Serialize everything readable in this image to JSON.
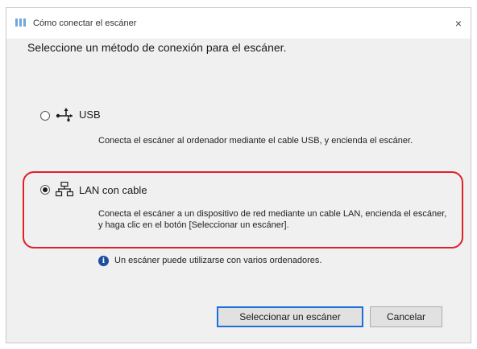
{
  "window": {
    "title": "Cómo conectar el escáner",
    "close_glyph": "×"
  },
  "heading": "Seleccione un método de conexión para el escáner.",
  "options": [
    {
      "label": "USB",
      "description": "Conecta el escáner al ordenador mediante el cable USB, y encienda el escáner.",
      "selected": false,
      "icon": "usb-icon"
    },
    {
      "label": "LAN con cable",
      "description": "Conecta el escáner a un dispositivo de red mediante un cable LAN, encienda el escáner, y haga clic en el botón [Seleccionar un escáner].",
      "selected": true,
      "icon": "network-icon"
    }
  ],
  "info": {
    "icon_glyph": "i",
    "text": "Un escáner puede utilizarse con varios ordenadores."
  },
  "buttons": {
    "select_label": "Seleccionar un escáner",
    "cancel_label": "Cancelar"
  },
  "colors": {
    "highlight": "#e0202a",
    "info_icon": "#1d4f9f",
    "focus_border": "#1e6fd9"
  }
}
